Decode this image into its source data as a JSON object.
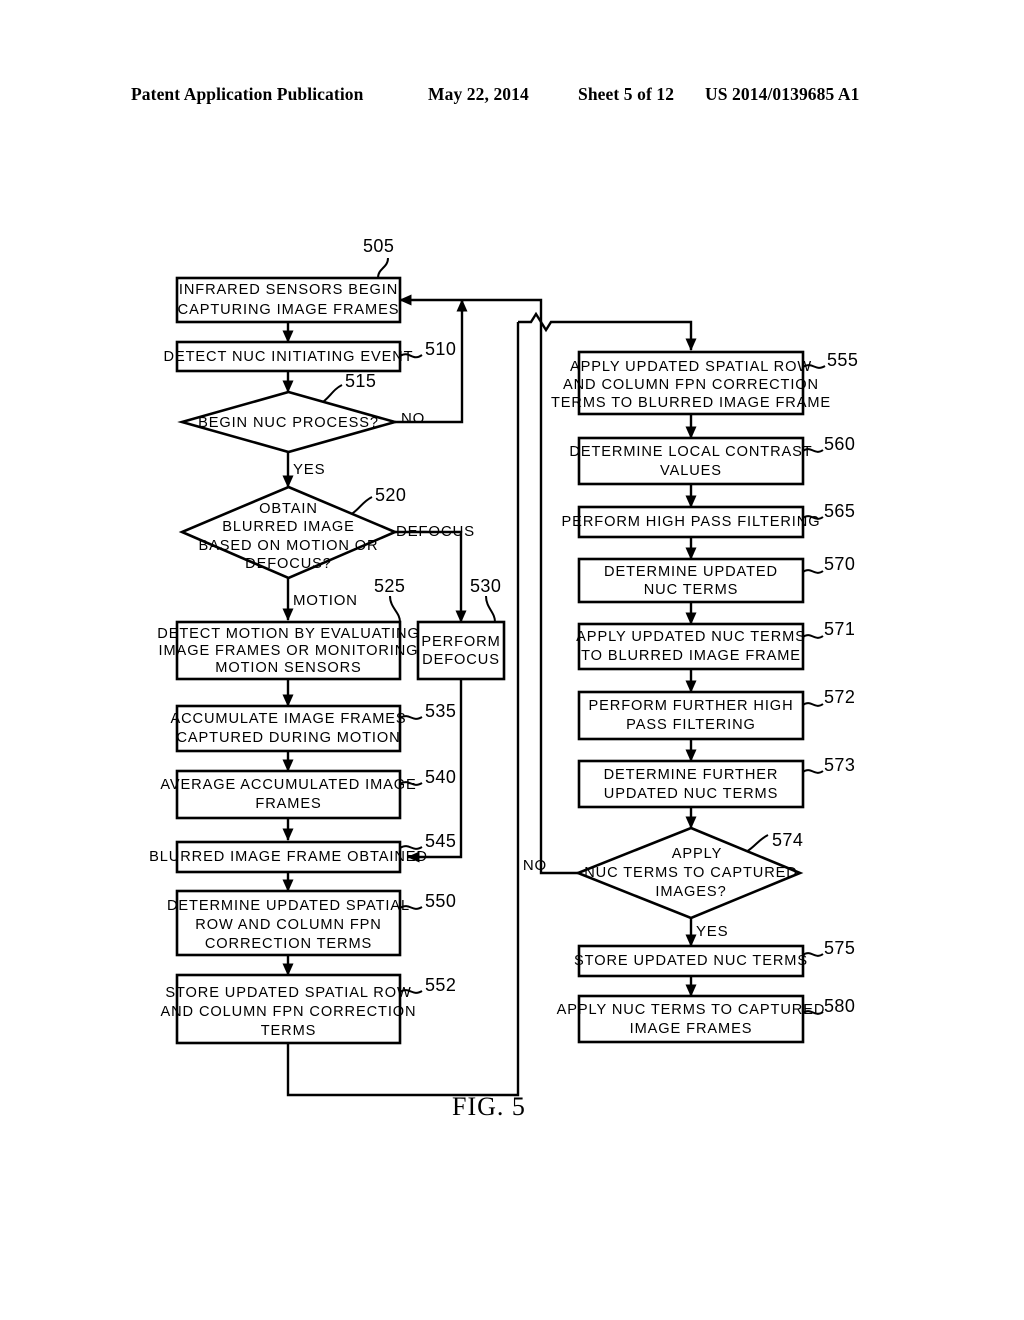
{
  "header": {
    "publication": "Patent Application Publication",
    "date": "May 22, 2014",
    "sheet": "Sheet 5 of 12",
    "patent_number": "US 2014/0139685 A1"
  },
  "figure": {
    "caption": "FIG.  5"
  },
  "nodes": {
    "n505": {
      "ref": "505",
      "type": "process",
      "lines": [
        "INFRARED SENSORS BEGIN",
        "CAPTURING IMAGE FRAMES"
      ]
    },
    "n510": {
      "ref": "510",
      "type": "process",
      "lines": [
        "DETECT NUC INITIATING EVENT"
      ]
    },
    "n515": {
      "ref": "515",
      "type": "decision",
      "lines": [
        "BEGIN NUC PROCESS?"
      ]
    },
    "n520": {
      "ref": "520",
      "type": "decision",
      "lines": [
        "OBTAIN",
        "BLURRED IMAGE",
        "BASED ON MOTION OR",
        "DEFOCUS?"
      ]
    },
    "n525": {
      "ref": "525",
      "type": "process",
      "lines": [
        "DETECT MOTION BY EVALUATING",
        "IMAGE FRAMES OR MONITORING",
        "MOTION SENSORS"
      ]
    },
    "n530": {
      "ref": "530",
      "type": "process",
      "lines": [
        "PERFORM",
        "DEFOCUS"
      ]
    },
    "n535": {
      "ref": "535",
      "type": "process",
      "lines": [
        "ACCUMULATE IMAGE FRAMES",
        "CAPTURED DURING MOTION"
      ]
    },
    "n540": {
      "ref": "540",
      "type": "process",
      "lines": [
        "AVERAGE ACCUMULATED IMAGE",
        "FRAMES"
      ]
    },
    "n545": {
      "ref": "545",
      "type": "process",
      "lines": [
        "BLURRED IMAGE FRAME OBTAINED"
      ]
    },
    "n550": {
      "ref": "550",
      "type": "process",
      "lines": [
        "DETERMINE UPDATED SPATIAL",
        "ROW AND COLUMN FPN",
        "CORRECTION TERMS"
      ]
    },
    "n552": {
      "ref": "552",
      "type": "process",
      "lines": [
        "STORE UPDATED SPATIAL ROW",
        "AND COLUMN FPN CORRECTION",
        "TERMS"
      ]
    },
    "n555": {
      "ref": "555",
      "type": "process",
      "lines": [
        "APPLY UPDATED SPATIAL ROW",
        "AND COLUMN FPN CORRECTION",
        "TERMS TO BLURRED IMAGE FRAME"
      ]
    },
    "n560": {
      "ref": "560",
      "type": "process",
      "lines": [
        "DETERMINE LOCAL CONTRAST",
        "VALUES"
      ]
    },
    "n565": {
      "ref": "565",
      "type": "process",
      "lines": [
        "PERFORM HIGH PASS FILTERING"
      ]
    },
    "n570": {
      "ref": "570",
      "type": "process",
      "lines": [
        "DETERMINE UPDATED",
        "NUC TERMS"
      ]
    },
    "n571": {
      "ref": "571",
      "type": "process",
      "lines": [
        "APPLY UPDATED NUC TERMS",
        "TO BLURRED IMAGE FRAME"
      ]
    },
    "n572": {
      "ref": "572",
      "type": "process",
      "lines": [
        "PERFORM FURTHER HIGH",
        "PASS FILTERING"
      ]
    },
    "n573": {
      "ref": "573",
      "type": "process",
      "lines": [
        "DETERMINE FURTHER",
        "UPDATED NUC TERMS"
      ]
    },
    "n574": {
      "ref": "574",
      "type": "decision",
      "lines": [
        "APPLY",
        "NUC TERMS TO CAPTURED",
        "IMAGES?"
      ]
    },
    "n575": {
      "ref": "575",
      "type": "process",
      "lines": [
        "STORE UPDATED NUC TERMS"
      ]
    },
    "n580": {
      "ref": "580",
      "type": "process",
      "lines": [
        "APPLY NUC TERMS TO CAPTURED",
        "IMAGE FRAMES"
      ]
    }
  },
  "edge_labels": {
    "e515_no": "NO",
    "e515_yes": "YES",
    "e520_defocus": "DEFOCUS",
    "e520_motion": "MOTION",
    "e574_no": "NO",
    "e574_yes": "YES"
  },
  "colors": {
    "ink": "#000000",
    "paper": "#ffffff"
  }
}
